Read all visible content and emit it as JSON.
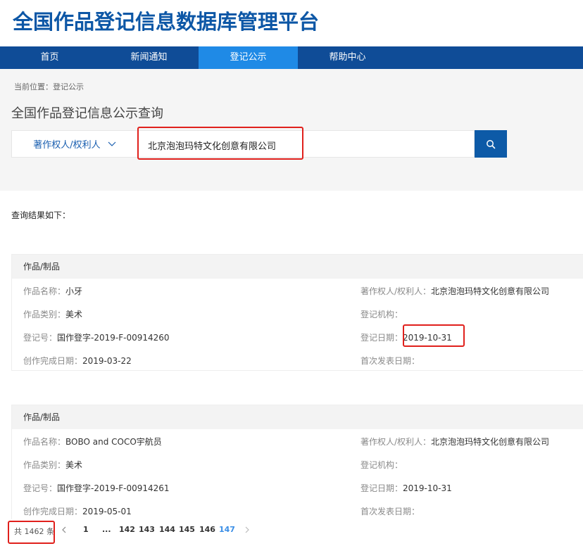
{
  "site": {
    "title": "全国作品登记信息数据库管理平台"
  },
  "nav": {
    "items": [
      {
        "label": "首页"
      },
      {
        "label": "新闻通知"
      },
      {
        "label": "登记公示"
      },
      {
        "label": "帮助中心"
      }
    ],
    "active_index": 2
  },
  "breadcrumb": "当前位置：登记公示",
  "search": {
    "title": "全国作品登记信息公示查询",
    "type_selected": "著作权人/权利人",
    "value": "北京泡泡玛特文化创意有限公司",
    "icons": {
      "dropdown": "chevron-down-icon",
      "submit": "search-icon"
    }
  },
  "results": {
    "label": "查询结果如下：",
    "cards": [
      {
        "header": "作品/制品",
        "name_k": "作品名称：",
        "name_v": "小牙",
        "owner_k": "著作权人/权利人：",
        "owner_v": "北京泡泡玛特文化创意有限公司",
        "category_k": "作品类别：",
        "category_v": "美术",
        "agency_k": "登记机构：",
        "agency_v": "",
        "regno_k": "登记号：",
        "regno_v": "国作登字-2019-F-00914260",
        "regdate_k": "登记日期：",
        "regdate_v": "2019-10-31",
        "created_k": "创作完成日期：",
        "created_v": "2019-03-22",
        "published_k": "首次发表日期：",
        "published_v": ""
      },
      {
        "header": "作品/制品",
        "name_k": "作品名称：",
        "name_v": "BOBO and COCO宇航员",
        "owner_k": "著作权人/权利人：",
        "owner_v": "北京泡泡玛特文化创意有限公司",
        "category_k": "作品类别：",
        "category_v": "美术",
        "agency_k": "登记机构：",
        "agency_v": "",
        "regno_k": "登记号：",
        "regno_v": "国作登字-2019-F-00914261",
        "regdate_k": "登记日期：",
        "regdate_v": "2019-10-31",
        "created_k": "创作完成日期：",
        "created_v": "2019-05-01",
        "published_k": "首次发表日期：",
        "published_v": ""
      }
    ]
  },
  "pagination": {
    "total": "共 1462 条",
    "pages": [
      "1",
      "...",
      "142",
      "143",
      "144",
      "145",
      "146",
      "147"
    ],
    "current": "147"
  },
  "colors": {
    "brand": "#0d57a6",
    "nav_bg": "#0f4c97",
    "nav_active": "#1f8ae6",
    "highlight": "#e0201c",
    "page_current": "#3a8ee6"
  }
}
